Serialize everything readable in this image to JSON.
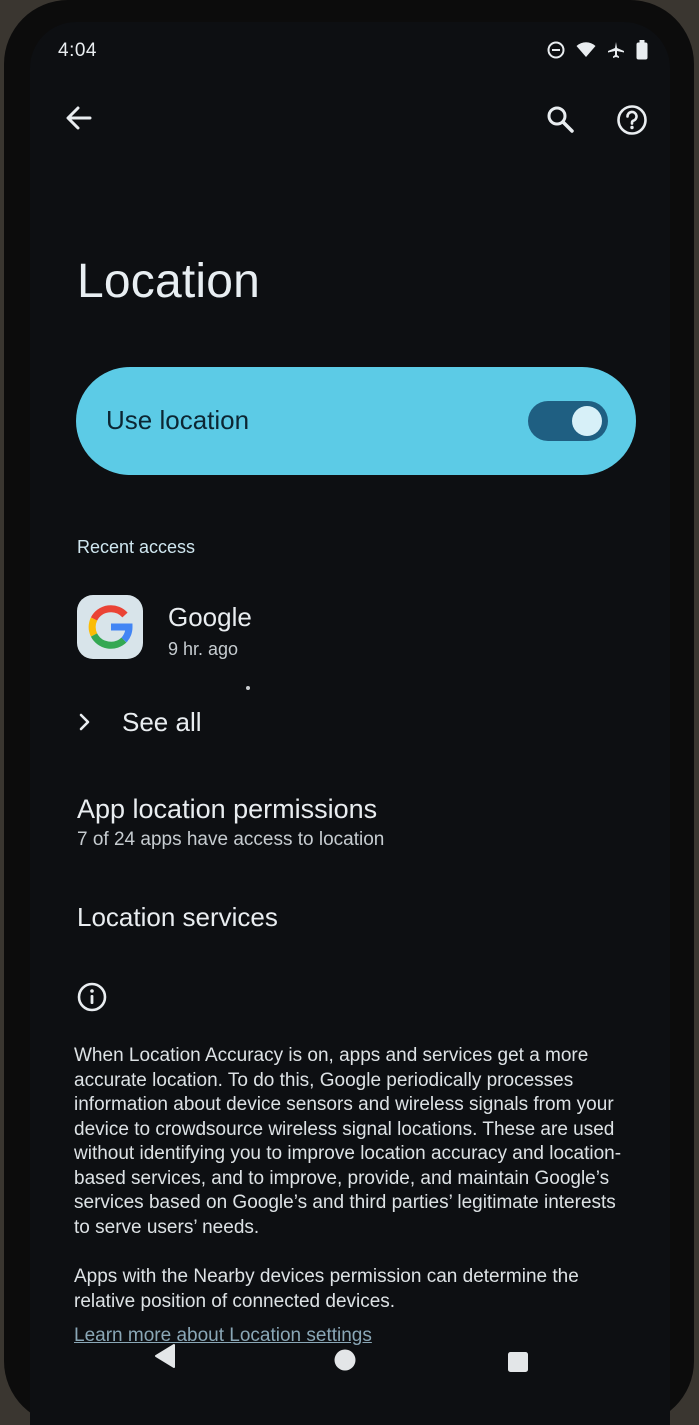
{
  "status_bar": {
    "time": "4:04",
    "icons": [
      "do-not-disturb-icon",
      "wifi-icon",
      "airplane-icon",
      "battery-icon"
    ]
  },
  "toolbar": {
    "back_icon": "arrow-left-icon",
    "search_icon": "search-icon",
    "help_icon": "help-circle-icon"
  },
  "page": {
    "title": "Location"
  },
  "use_location": {
    "label": "Use location",
    "enabled": true,
    "accent_color": "#5ccbe6"
  },
  "recent_access": {
    "section_label": "Recent access",
    "apps": [
      {
        "name": "Google",
        "time": "9 hr. ago",
        "icon": "google-g-icon"
      }
    ],
    "see_all_label": "See all"
  },
  "app_permissions": {
    "title": "App location permissions",
    "subtitle": "7 of 24 apps have access to location"
  },
  "location_services": {
    "title": "Location services"
  },
  "info": {
    "icon": "info-icon",
    "paragraph1": "When Location Accuracy is on, apps and services get a more accurate location. To do this, Google periodically processes information about device sensors and wireless signals from your device to crowdsource wireless signal locations. These are used without identifying you to improve location accuracy and location-based services, and to improve, provide, and maintain Google’s services based on Google’s and third parties’ legitimate interests to serve users’ needs.",
    "paragraph2": "Apps with the Nearby devices permission can determine the relative position of connected devices.",
    "learn_more": "Learn more about Location settings"
  },
  "nav_bar": {
    "back": "triangle-back-icon",
    "home": "circle-home-icon",
    "recents": "square-recents-icon"
  }
}
